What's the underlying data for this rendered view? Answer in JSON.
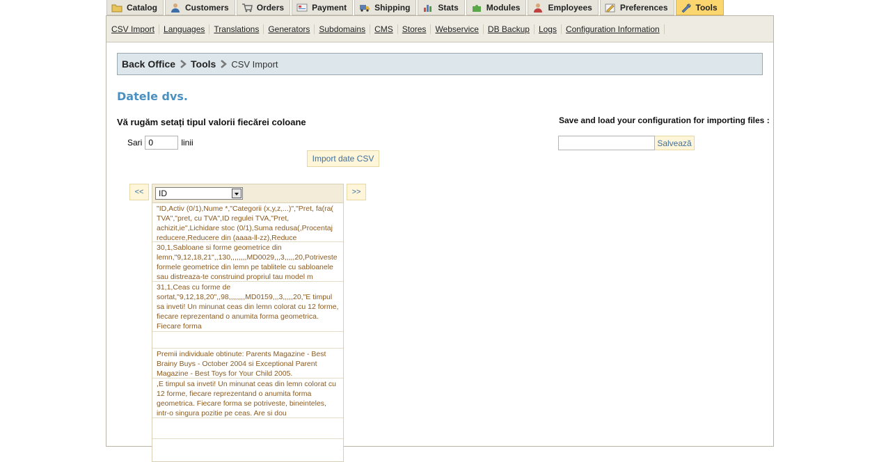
{
  "tabs": [
    {
      "label": "Catalog",
      "icon": "folder-icon",
      "active": false
    },
    {
      "label": "Customers",
      "icon": "user-icon",
      "active": false
    },
    {
      "label": "Orders",
      "icon": "cart-icon",
      "active": false
    },
    {
      "label": "Payment",
      "icon": "payment-icon",
      "active": false
    },
    {
      "label": "Shipping",
      "icon": "truck-icon",
      "active": false
    },
    {
      "label": "Stats",
      "icon": "bar-chart-icon",
      "active": false
    },
    {
      "label": "Modules",
      "icon": "puzzle-icon",
      "active": false
    },
    {
      "label": "Employees",
      "icon": "employee-icon",
      "active": false
    },
    {
      "label": "Preferences",
      "icon": "preferences-icon",
      "active": false
    },
    {
      "label": "Tools",
      "icon": "wrench-icon",
      "active": true
    }
  ],
  "subnav": [
    "CSV Import",
    "Languages",
    "Translations",
    "Generators",
    "Subdomains",
    "CMS",
    "Stores",
    "Webservice",
    "DB Backup",
    "Logs",
    "Configuration Information"
  ],
  "breadcrumb": {
    "root": "Back Office",
    "section": "Tools",
    "current": "CSV Import"
  },
  "heading": "Datele dvs.",
  "subheading": "Vă rugăm setați tipul valorii fiecărei coloane",
  "skip": {
    "label_before": "Sari",
    "value": "0",
    "label_after": "linii"
  },
  "import_button": "Import date CSV",
  "config": {
    "label": "Save and load your configuration for importing files :",
    "input_value": "",
    "save_button": "Salvează"
  },
  "pager": {
    "prev": "<<",
    "next": ">>"
  },
  "column": {
    "selected_type": "ID",
    "cells": [
      "\"ID,Activ (0/1),Nume *,\"Categorii (x,y,z,...)\",\"Pret, fa(ra( TVA\",\"pret, cu TVA\",ID regulei TVA,\"Pret, achizit,ie\",Lichidare stoc (0/1),Suma redusa(,Procentaj reducere,Reducere din (aaaa-ll-zz),Reduce",
      "30,1,Sabloane si forme geometrice din lemn,\"9,12,18,21\",,130,,,,,,,,MD0029,,,3,,,,,20,Potriveste formele geometrice din lemn pe tablitele cu sabloanele sau distreaza-te construind propriul tau model m",
      "31,1,Ceas cu forme de sortat,\"9,12,18,20\",,98,,,,,,,,MD0159,,,3,,,,,20,\"E timpul sa inveti! Un minunat ceas din lemn colorat cu 12 forme, fiecare reprezentand o anumita forma geometrica. Fiecare forma",
      "",
      "Premii individuale obtinute: Parents Magazine - Best Brainy Buys - October 2004 si Exceptional Parent Magazine - Best Toys for Your Child 2005.",
      ",E timpul sa inveti! Un minunat ceas din lemn colorat cu 12 forme, fiecare reprezentand o anumita forma geometrica. Fiecare forma se potriveste, bineinteles, intr-o singura pozitie pe ceas. Are si dou",
      ""
    ]
  },
  "colors": {
    "accent_blue": "#4a90c0",
    "active_tab": "#fbd56d",
    "cell_text": "#8a5a20"
  }
}
